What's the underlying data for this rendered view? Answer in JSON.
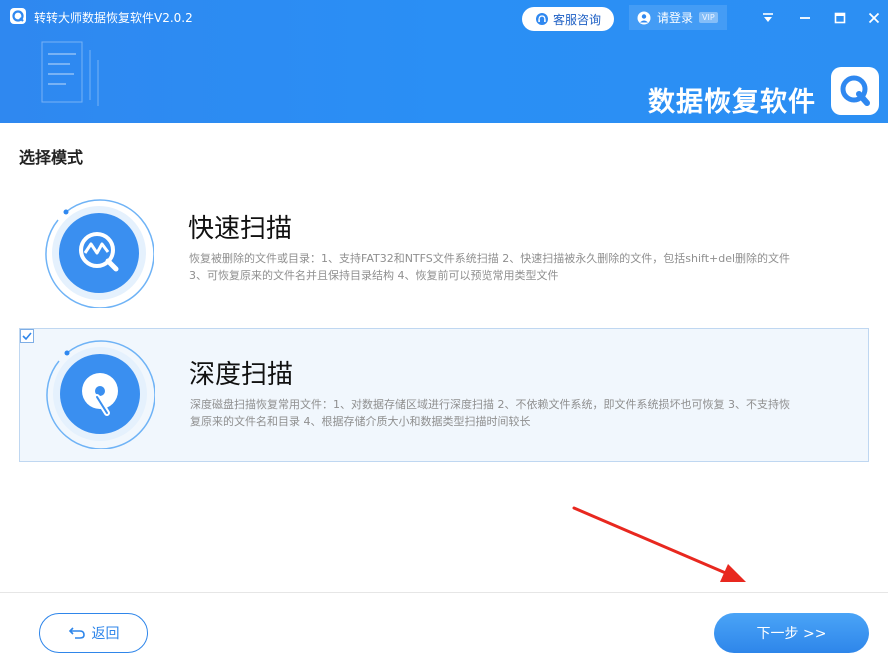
{
  "window": {
    "title": "转转大师数据恢复软件V2.0.2",
    "service_label": "客服咨询",
    "login_label": "请登录",
    "vip_label": "VIP"
  },
  "banner": {
    "title": "数据恢复软件"
  },
  "main": {
    "section_title": "选择模式",
    "options": [
      {
        "title": "快速扫描",
        "description": "恢复被删除的文件或目录：1、支持FAT32和NTFS文件系统扫描 2、快速扫描被永久删除的文件，包括shift+del删除的文件 3、可恢复原来的文件名并且保持目录结构 4、恢复前可以预览常用类型文件",
        "selected": false,
        "icon": "chart-magnifier-icon"
      },
      {
        "title": "深度扫描",
        "description": "深度磁盘扫描恢复常用文件：1、对数据存储区域进行深度扫描 2、不依赖文件系统，即文件系统损坏也可恢复 3、不支持恢复原来的文件名和目录 4、根据存储介质大小和数据类型扫描时间较长",
        "selected": true,
        "icon": "disk-scan-icon"
      }
    ]
  },
  "footer": {
    "back_label": "返回",
    "next_label": "下一步 >>"
  },
  "colors": {
    "brand_blue": "#2f88f0",
    "selected_bg": "#f1f7fd",
    "arrow_red": "#e8281f"
  }
}
